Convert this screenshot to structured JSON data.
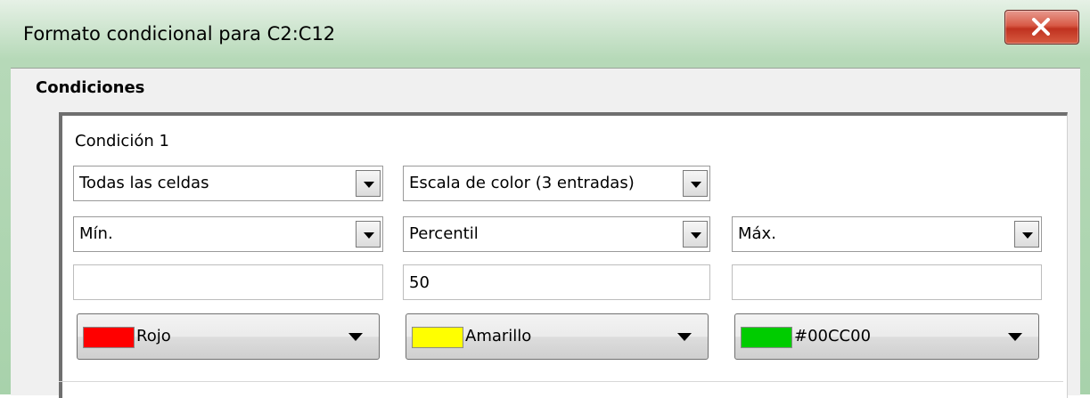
{
  "window": {
    "title": "Formato condicional para C2:C12"
  },
  "section": {
    "title": "Condiciones"
  },
  "condition": {
    "label": "Condición 1",
    "scope_value": "Todas las celdas",
    "type_value": "Escala de color (3 entradas)",
    "min": {
      "type": "Mín.",
      "value": "",
      "color_name": "Rojo",
      "color_hex": "#FF0000"
    },
    "mid": {
      "type": "Percentil",
      "value": "50",
      "color_name": "Amarillo",
      "color_hex": "#FFFF00"
    },
    "max": {
      "type": "Máx.",
      "value": "",
      "color_name": "#00CC00",
      "color_hex": "#00CC00"
    }
  },
  "icons": {
    "close": "close-icon",
    "dropdown": "chevron-down-icon"
  },
  "colors": {
    "close_button": "#D0412C",
    "title_bar": "#A8D2AB"
  }
}
